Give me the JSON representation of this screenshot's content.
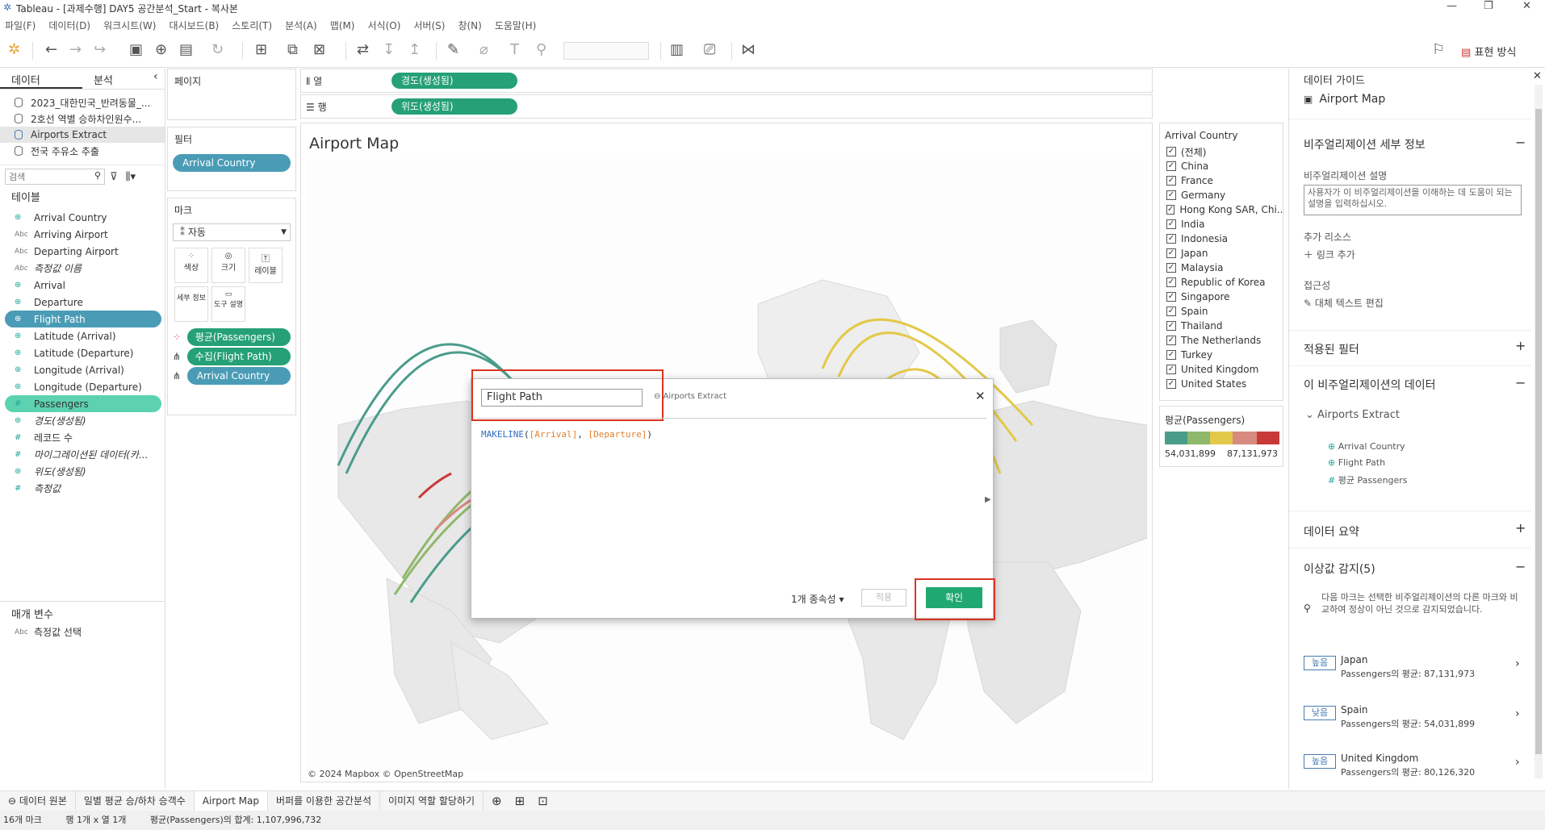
{
  "app": {
    "title": "Tableau - [과제수행] DAY5 공간분석_Start - 복사본"
  },
  "menu": [
    "파일(F)",
    "데이터(D)",
    "워크시트(W)",
    "대시보드(B)",
    "스토리(T)",
    "분석(A)",
    "맵(M)",
    "서식(O)",
    "서버(S)",
    "창(N)",
    "도움말(H)"
  ],
  "toolbar": {
    "present_label": "표현 방식"
  },
  "left": {
    "tab_data": "데이터",
    "tab_analysis": "분석",
    "datasources": [
      "2023_대한민국_반려동물_...",
      "2호선 역별 승하차인원수...",
      "Airports Extract",
      "전국 주유소 추출"
    ],
    "search_placeholder": "검색",
    "tables_header": "테이블",
    "fields": [
      {
        "icon": "globe",
        "label": "Arrival Country"
      },
      {
        "icon": "Abc",
        "label": "Arriving Airport"
      },
      {
        "icon": "Abc",
        "label": "Departing Airport"
      },
      {
        "icon": "Abc",
        "label": "측정값 이름"
      },
      {
        "icon": "geo",
        "label": "Arrival"
      },
      {
        "icon": "geo",
        "label": "Departure"
      },
      {
        "icon": "geo",
        "label": "Flight Path"
      },
      {
        "icon": "globe",
        "label": "Latitude (Arrival)"
      },
      {
        "icon": "globe",
        "label": "Latitude (Departure)"
      },
      {
        "icon": "globe",
        "label": "Longitude (Arrival)"
      },
      {
        "icon": "globe",
        "label": "Longitude (Departure)"
      },
      {
        "icon": "#",
        "label": "Passengers"
      },
      {
        "icon": "globe",
        "label": "경도(생성됨)"
      },
      {
        "icon": "#",
        "label": "레코드 수"
      },
      {
        "icon": "#",
        "label": "마이그레이션된 데이터(카..."
      },
      {
        "icon": "globe",
        "label": "위도(생성됨)"
      },
      {
        "icon": "#",
        "label": "측정값"
      }
    ],
    "params_header": "매개 변수",
    "params": [
      {
        "icon": "Abc",
        "label": "측정값 선택"
      }
    ]
  },
  "cards": {
    "pages": "페이지",
    "filters": "필터",
    "filter_pill": "Arrival Country",
    "marks": "마크",
    "mark_type": "자동",
    "mark_buttons": [
      "색상",
      "크기",
      "레이블",
      "세부 정보",
      "도구 설명"
    ],
    "mark_pills": [
      "평균(Passengers)",
      "수집(Flight Path)",
      "Arrival Country"
    ]
  },
  "shelves": {
    "cols_label": "열",
    "cols_pill": "경도(생성됨)",
    "rows_label": "행",
    "rows_pill": "위도(생성됨)"
  },
  "view": {
    "title": "Airport Map",
    "credit": "© 2024 Mapbox © OpenStreetMap"
  },
  "legend": {
    "title": "Arrival Country",
    "items": [
      "(전체)",
      "China",
      "France",
      "Germany",
      "Hong Kong SAR, Chi...",
      "India",
      "Indonesia",
      "Japan",
      "Malaysia",
      "Republic of Korea",
      "Singapore",
      "Spain",
      "Thailand",
      "The Netherlands",
      "Turkey",
      "United Kingdom",
      "United States"
    ]
  },
  "color_legend": {
    "title": "평균(Passengers)",
    "min": "54,031,899",
    "max": "87,131,973",
    "colors": [
      "#4a9c8a",
      "#8fb86a",
      "#e3c94a",
      "#d88a80",
      "#c83a3a"
    ]
  },
  "dialog": {
    "name": "Flight Path",
    "source": "Airports Extract",
    "formula_fn": "MAKELINE",
    "formula_a": "[Arrival]",
    "formula_b": "[Departure]",
    "deps": "1개 종속성",
    "apply": "적용",
    "ok": "확인"
  },
  "guide": {
    "header": "데이터 가이드",
    "sheet": "Airport Map",
    "viz_details": "비주얼리제이션 세부 정보",
    "desc_label": "비주얼리제이션 설명",
    "desc_placeholder": "사용자가 이 비주얼리제이션을 이해하는 데 도움이 되는 설명을 입력하십시오.",
    "extra": "추가 리소스",
    "add_link": "링크 추가",
    "access": "접근성",
    "alt": "대체 텍스트 편집",
    "applied": "적용된 필터",
    "viz_data": "이 비주얼리제이션의 데이터",
    "ds": "Airports Extract",
    "ds_fields": [
      "Arrival Country",
      "Flight Path",
      "평균 Passengers"
    ],
    "summary": "데이터 요약",
    "outliers": "이상값 감지(5)",
    "outlier_desc": "다음 마크는 선택한 비주얼리제이션의 다른 마크와 비교하여 정상이 아닌 것으로 감지되었습니다.",
    "items": [
      {
        "badge": "높음",
        "name": "Japan",
        "value": "Passengers의 평균: 87,131,973"
      },
      {
        "badge": "낮음",
        "name": "Spain",
        "value": "Passengers의 평균: 54,031,899"
      },
      {
        "badge": "높음",
        "name": "United Kingdom",
        "value": "Passengers의 평균: 80,126,320"
      }
    ]
  },
  "sheets": [
    "데이터 원본",
    "일별 평균 승/하차 승객수",
    "Airport Map",
    "버퍼를 이용한 공간분석",
    "이미지 역할 할당하기"
  ],
  "status": {
    "marks": "16개 마크",
    "rows": "행 1개 x 열 1개",
    "sum": "평균(Passengers)의 합계: 1,107,996,732"
  }
}
